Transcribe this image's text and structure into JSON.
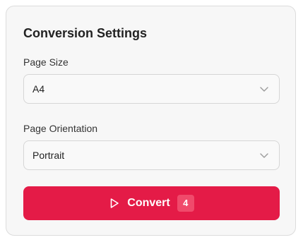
{
  "settings": {
    "title": "Conversion Settings",
    "page_size": {
      "label": "Page Size",
      "value": "A4"
    },
    "page_orientation": {
      "label": "Page Orientation",
      "value": "Portrait"
    },
    "convert_button": {
      "label": "Convert",
      "count": "4",
      "icon": "play-icon"
    }
  },
  "colors": {
    "accent": "#e41b47",
    "badge": "#f04a6b",
    "card_background": "#f7f7f7",
    "border": "#dcdcdc"
  }
}
